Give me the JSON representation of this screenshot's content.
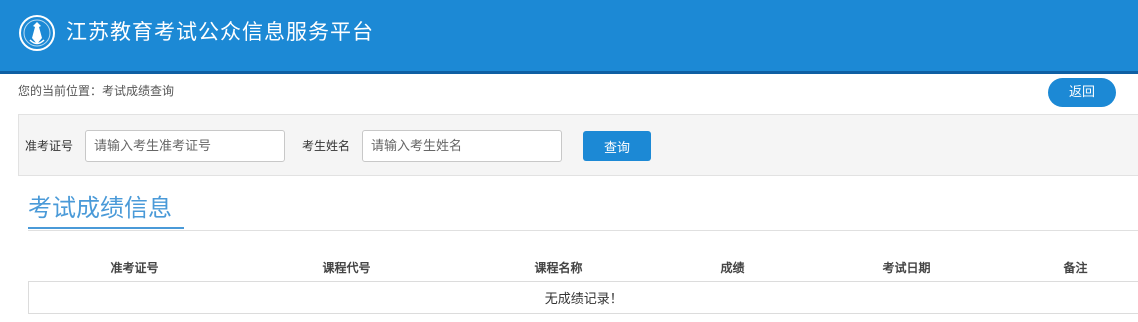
{
  "header": {
    "title": "江苏教育考试公众信息服务平台",
    "logo_icon": "exam-authority-emblem-icon",
    "background_color": "#1c89d5"
  },
  "breadcrumb": {
    "text": "您的当前位置：考试成绩查询"
  },
  "back_button": {
    "label": "返回"
  },
  "search": {
    "admission_label": "准考证号",
    "admission_placeholder": "请输入考生准考证号",
    "admission_value": "",
    "name_label": "考生姓名",
    "name_placeholder": "请输入考生姓名",
    "name_value": "",
    "query_label": "查询"
  },
  "section": {
    "title": "考试成绩信息"
  },
  "table": {
    "columns": [
      "准考证号",
      "课程代号",
      "课程名称",
      "成绩",
      "考试日期",
      "备注"
    ],
    "empty_message": "无成绩记录！"
  }
}
